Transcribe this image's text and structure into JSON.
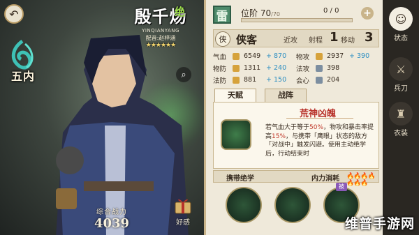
{
  "hero": {
    "name": "殷千炀",
    "rank_tag": "绝",
    "pinyin": "YINQIANYANG",
    "voice_actor": "配音:赵梓涵",
    "stars": "★★★★★★",
    "faction": "五内",
    "power_label": "综合战力",
    "power_value": "4039",
    "gift_label": "好感"
  },
  "element": "雷",
  "rank": {
    "label": "位阶",
    "value": "70",
    "max": "/70",
    "fragments": "0 / 0",
    "progress": 0
  },
  "class": {
    "icon": "侠",
    "name": "侠客",
    "range_label": "近攻",
    "shot_label": "射程",
    "shot_value": "1",
    "move_label": "移动",
    "move_value": "3"
  },
  "stats": [
    {
      "label": "气血",
      "base": "6549",
      "bonus": "+ 870"
    },
    {
      "label": "物攻",
      "base": "2937",
      "bonus": "+ 390"
    },
    {
      "label": "物防",
      "base": "1311",
      "bonus": "+ 240"
    },
    {
      "label": "法攻",
      "base": "398",
      "bonus": ""
    },
    {
      "label": "法防",
      "base": "881",
      "bonus": "+ 150"
    },
    {
      "label": "会心",
      "base": "204",
      "bonus": ""
    }
  ],
  "tabs": [
    "天赋",
    "战阵"
  ],
  "talent": {
    "title": "荒神凶魄",
    "desc_1": "若气血大于等于",
    "desc_hl1": "50%",
    "desc_2": "，物攻和暴击率提高",
    "desc_hl2": "15%",
    "desc_3": "，与携带「鹰眼」状态的敌方「对战中」触发闪避。使用主动绝学后，行动结束时"
  },
  "skills": {
    "title": "携带绝学",
    "energy_label": "内力消耗",
    "energy_drops": "🔥🔥🔥🔥🔥🔥🔥",
    "badge": "被"
  },
  "side_menu": [
    {
      "label": "状态",
      "icon": "portrait-icon"
    },
    {
      "label": "兵刀",
      "icon": "sword-icon"
    },
    {
      "label": "衣装",
      "icon": "robe-icon"
    }
  ],
  "watermark": "维普手游网",
  "colors": {
    "accent": "#b8322a",
    "bonus": "#2e8fc2",
    "element": "#4e8a6a"
  }
}
